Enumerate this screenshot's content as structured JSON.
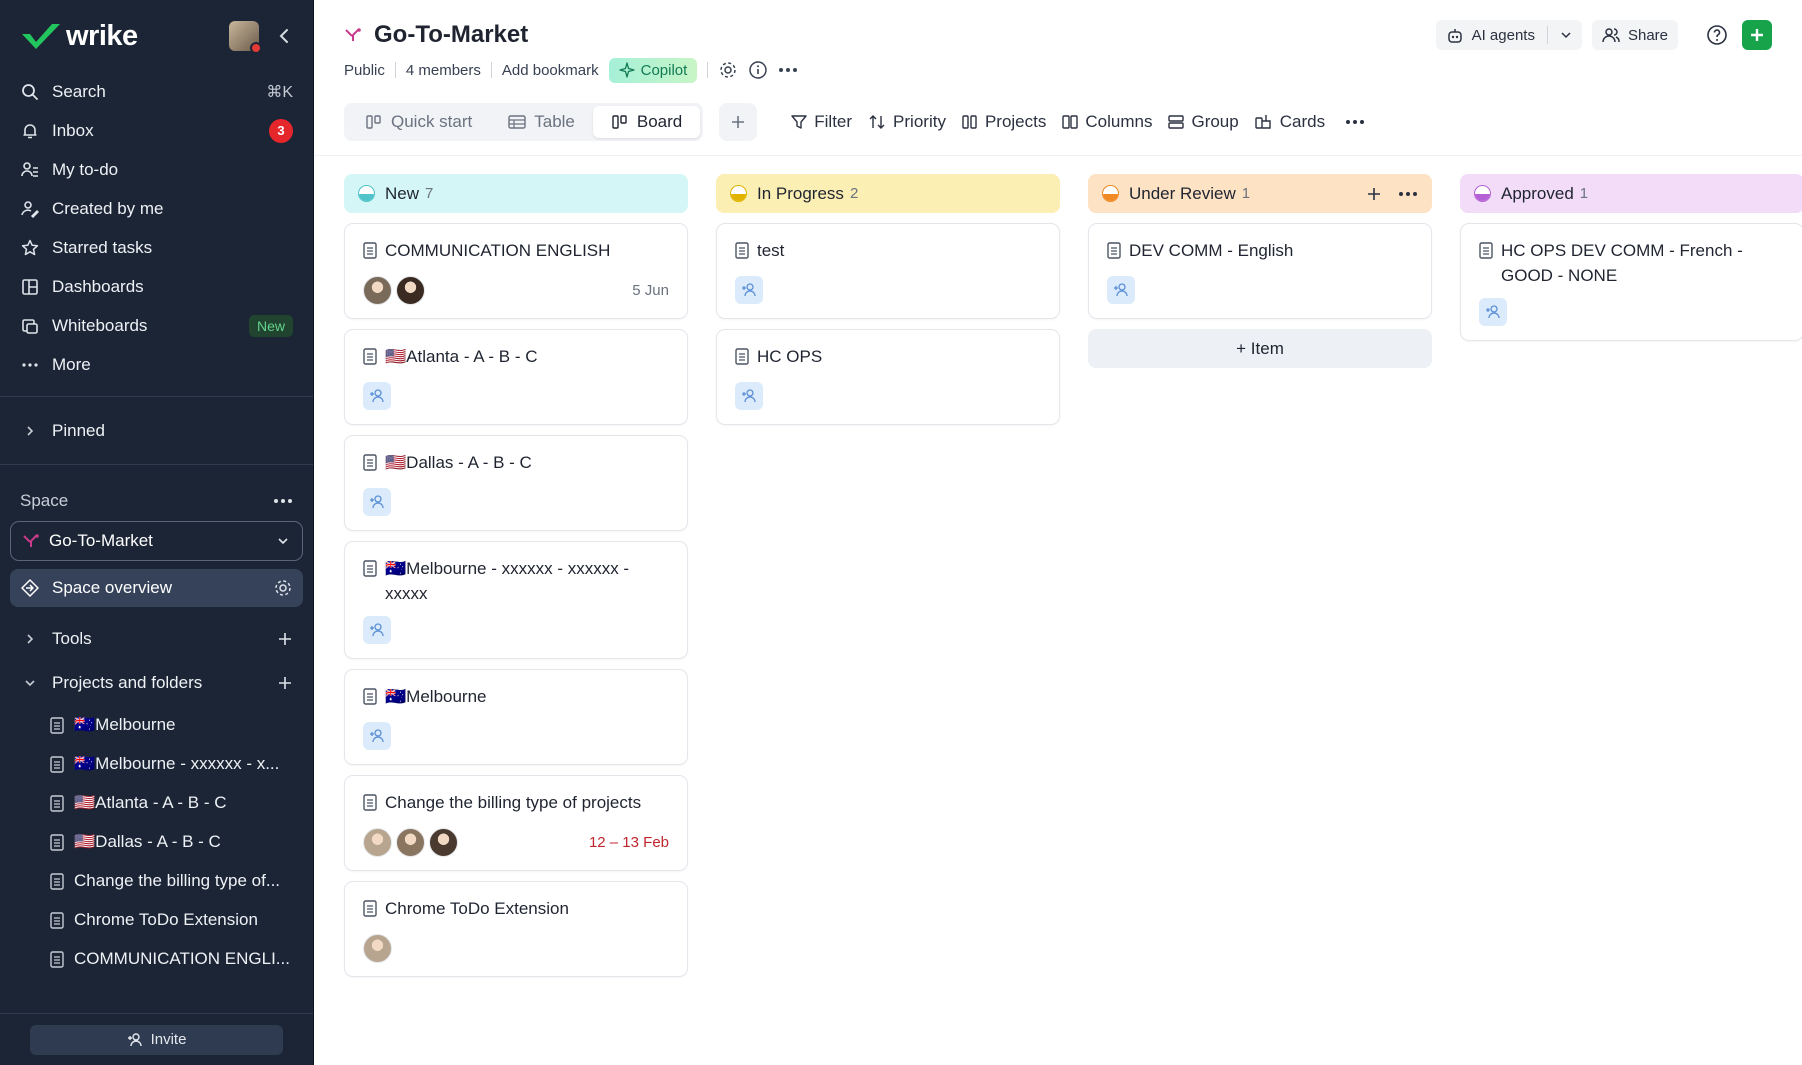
{
  "sidebar": {
    "brand": "wrike",
    "nav": [
      {
        "label": "Search",
        "icon": "search-icon",
        "shortcut": "⌘K"
      },
      {
        "label": "Inbox",
        "icon": "bell-icon",
        "badge": "3"
      },
      {
        "label": "My to-do",
        "icon": "user-list-icon"
      },
      {
        "label": "Created by me",
        "icon": "user-pen-icon"
      },
      {
        "label": "Starred tasks",
        "icon": "star-icon"
      },
      {
        "label": "Dashboards",
        "icon": "dashboard-icon"
      },
      {
        "label": "Whiteboards",
        "icon": "whiteboard-icon",
        "tag": "New"
      },
      {
        "label": "More",
        "icon": "more-icon"
      }
    ],
    "pinned_label": "Pinned",
    "space_label": "Space",
    "space_selected": "Go-To-Market",
    "space_overview": "Space overview",
    "tools_label": "Tools",
    "projects_label": "Projects and folders",
    "tree": [
      {
        "flag": "🇦🇺",
        "label": "Melbourne"
      },
      {
        "flag": "🇦🇺",
        "label": "Melbourne - xxxxxx - x..."
      },
      {
        "flag": "🇺🇸",
        "label": "Atlanta - A - B - C"
      },
      {
        "flag": "🇺🇸",
        "label": "Dallas - A - B - C"
      },
      {
        "flag": "",
        "label": "Change the billing type of..."
      },
      {
        "flag": "",
        "label": "Chrome ToDo Extension"
      },
      {
        "flag": "",
        "label": "COMMUNICATION ENGLI..."
      }
    ],
    "invite_label": "Invite"
  },
  "header": {
    "title": "Go-To-Market",
    "ai_agents": "AI agents",
    "share": "Share",
    "meta": {
      "visibility": "Public",
      "members": "4 members",
      "bookmark": "Add bookmark",
      "copilot": "Copilot"
    },
    "tabs": [
      {
        "label": "Quick start",
        "active": false
      },
      {
        "label": "Table",
        "active": false
      },
      {
        "label": "Board",
        "active": true
      }
    ],
    "tools": [
      "Filter",
      "Priority",
      "Projects",
      "Columns",
      "Group",
      "Cards"
    ]
  },
  "board": {
    "columns": [
      {
        "name": "New",
        "count": "7",
        "color": "#4fc3c9",
        "bg": "#d4f6f7",
        "cards": [
          {
            "flag": "",
            "title": "COMMUNICATION ENGLISH",
            "people": [
              "#7a6a5a",
              "#3b2a22"
            ],
            "date": "5 Jun",
            "date_red": false
          },
          {
            "flag": "🇺🇸",
            "title": "Atlanta - A - B - C",
            "people": [],
            "date": ""
          },
          {
            "flag": "🇺🇸",
            "title": "Dallas - A - B - C",
            "people": [],
            "date": ""
          },
          {
            "flag": "🇦🇺",
            "title": "Melbourne - xxxxxx - xxxxxx - xxxxx",
            "people": [],
            "date": ""
          },
          {
            "flag": "🇦🇺",
            "title": "Melbourne",
            "people": [],
            "date": ""
          },
          {
            "flag": "",
            "title": "Change the billing type of projects",
            "people": [
              "#b7a58f",
              "#8a7560",
              "#4a3a30"
            ],
            "date": "12 – 13 Feb",
            "date_red": true
          },
          {
            "flag": "",
            "title": "Chrome ToDo Extension",
            "people": [
              "#b7a58f"
            ],
            "date": ""
          }
        ]
      },
      {
        "name": "In Progress",
        "count": "2",
        "color": "#e0b400",
        "bg": "#fcefb4",
        "cards": [
          {
            "flag": "",
            "title": "test",
            "people": [],
            "date": ""
          },
          {
            "flag": "",
            "title": "HC OPS",
            "people": [],
            "date": ""
          }
        ]
      },
      {
        "name": "Under Review",
        "count": "1",
        "color": "#f08a24",
        "bg": "#fde2c4",
        "add_item": "+ Item",
        "cards": [
          {
            "flag": "",
            "title": "DEV COMM - English",
            "people": [],
            "date": ""
          }
        ]
      },
      {
        "name": "Approved",
        "count": "1",
        "color": "#b660d6",
        "bg": "#f2dcf8",
        "cards": [
          {
            "flag": "",
            "title": "HC OPS DEV COMM - French - GOOD - NONE",
            "people": [],
            "date": ""
          }
        ]
      }
    ]
  }
}
